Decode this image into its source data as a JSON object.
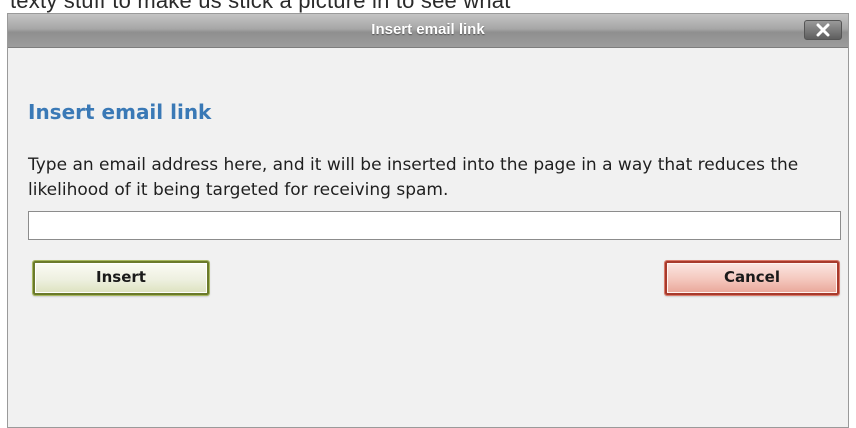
{
  "background": {
    "partial_text": "texty stuff to make us stick a picture in to see what"
  },
  "dialog": {
    "title": "Insert email link",
    "close_icon": "close-icon",
    "heading": "Insert email link",
    "description": "Type an email address here, and it will be inserted into the page in a way that reduces the likelihood of it being targeted for receiving spam.",
    "email_value": "",
    "insert_label": "Insert",
    "cancel_label": "Cancel"
  },
  "colors": {
    "heading": "#3a79b6",
    "insert_border": "#6b7a2a",
    "cancel_border": "#a83a2c",
    "titlebar": "#9c9c9c"
  }
}
